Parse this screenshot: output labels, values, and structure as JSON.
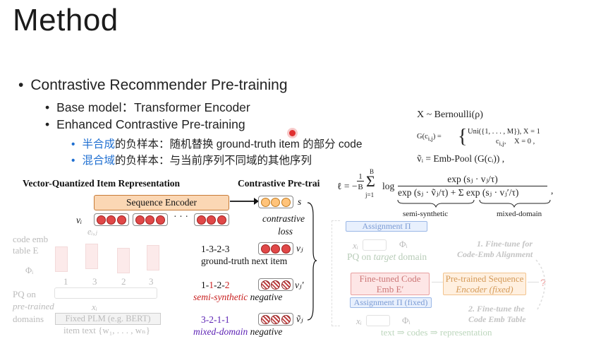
{
  "slide": {
    "title": "Method",
    "bullet1": "Contrastive Recommender Pre-training",
    "bullet2a": "Base model：Transformer Encoder",
    "bullet2b": "Enhanced Contrastive Pre-training",
    "bullet3a_hl": "半合成",
    "bullet3a_rest": "的负样本：随机替换 ground-truth item 的部分 code",
    "bullet3b_hl": "混合域",
    "bullet3b_rest": "的负样本：与当前序列不同域的其他序列"
  },
  "formulas": {
    "f1": "X ~ Bernoulli(ρ)",
    "f2_lhs": "G(c",
    "f2_row1": "Uni({1, . . . , M}),     X = 1",
    "f2_row2": "c",
    "f2_row2b": "X = 0",
    "f3": "ṽᵢ = Emb-Pool (G(cᵢ)) ,",
    "loss_lhs": "ℓ = −",
    "loss_frac_num": "1",
    "loss_frac_den": "B",
    "loss_sum_top": "B",
    "loss_sum_bot": "j=1",
    "loss_log": "log",
    "loss_num": "exp (sⱼ · vⱼ/τ)",
    "loss_den": "exp (sⱼ · ṽⱼ/τ) + Σ exp (sⱼ · vⱼ′/τ)",
    "brace1": "semi-synthetic",
    "brace2": "mixed-domain",
    "loss_tail": ","
  },
  "figure_left": {
    "title_vq": "Vector-Quantized Item Representation",
    "title_cp": "Contrastive Pre-trai",
    "seq_encoder": "Sequence Encoder",
    "s_label": "s",
    "vi": "vᵢ",
    "dots": "· · ·",
    "eij": "eᵢ,ⱼ",
    "code_emb": "code emb",
    "table_e": "table E",
    "phi_i": "Φᵢ",
    "digits": [
      "1",
      "3",
      "2",
      "3"
    ],
    "pq": "PQ on",
    "pretrained": "pre-trained",
    "domains": "domains",
    "xi": "xᵢ",
    "plm": "Fixed PLM (e.g. BERT)",
    "item_text": "item text {w₁, . . . , wₙ}",
    "contrastive": "contrastive",
    "loss": "loss",
    "gt_code": "1-3-2-3",
    "gt_label": "ground-truth next item",
    "vj": "vⱼ",
    "semi_code_a": "1-",
    "semi_code_b": "1",
    "semi_code_c": "-2-",
    "semi_code_d": "2",
    "semi_label_a": "semi-synthetic",
    "semi_label_b": " negative",
    "vj_tilde": "vⱼ′",
    "mixed_code": "3-2-1-1",
    "mixed_label_a": "mixed-domain",
    "mixed_label_b": " negative",
    "vj_tilde2": "ṽⱼ"
  },
  "figure_right": {
    "assign_top": "Assignment Π",
    "xi": "xᵢ",
    "phi": "Φᵢ",
    "pq_target_a": "PQ on ",
    "pq_target_b": "target",
    "pq_target_c": " domain",
    "ft1": "1. Fine-tune for",
    "ft1b": "Code-Emb Alignment",
    "finetuned_code": "Fine-tuned Code",
    "emb_e": "Emb E′",
    "pretrained_seq": "Pre-trained Sequence",
    "encoder_fixed": "Encoder (fixed)",
    "q": "?",
    "assign_fixed": "Assignment Π (fixed)",
    "ft2": "2. Fine-tune the",
    "ft2b": "Code Emb Table",
    "xi2": "xᵢ",
    "phi2": "Φᵢ",
    "bottom": "text ⇒ codes ⇒ representation"
  }
}
